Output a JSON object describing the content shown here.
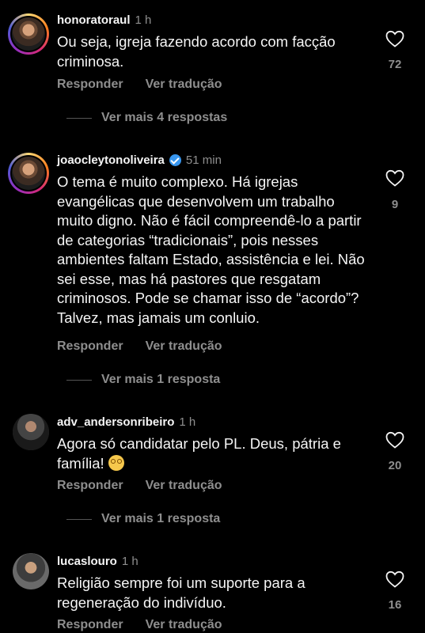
{
  "comments": [
    {
      "username": "honoratoraul",
      "time": "1 h",
      "text": "Ou seja, igreja fazendo acordo com facção criminosa.",
      "likes": "72",
      "verified": false,
      "reply_label": "Responder",
      "translate_label": "Ver tradução",
      "more_replies": "Ver mais 4 respostas"
    },
    {
      "username": "joaocleytonoliveira",
      "time": "51 min",
      "text": "O tema é muito complexo. Há igrejas evangélicas que desenvolvem um trabalho muito digno. Não é fácil compreendê-lo a partir de categorias “tradicionais”, pois nesses ambientes faltam Estado, assistência e lei. Não sei esse, mas há pastores que resgatam criminosos. Pode se chamar isso de “acordo”? Talvez, mas jamais um conluio.",
      "likes": "9",
      "verified": true,
      "reply_label": "Responder",
      "translate_label": "Ver tradução",
      "more_replies": "Ver mais 1 resposta"
    },
    {
      "username": "adv_andersonribeiro",
      "time": "1 h",
      "text": "Agora só candidatar pelo PL. Deus, pátria e família!",
      "emoji": "flushed-face",
      "likes": "20",
      "verified": false,
      "reply_label": "Responder",
      "translate_label": "Ver tradução",
      "more_replies": "Ver mais 1 resposta"
    },
    {
      "username": "lucaslouro",
      "time": "1 h",
      "text": "Religião sempre foi um suporte para a regeneração do indivíduo.",
      "likes": "16",
      "verified": false,
      "reply_label": "Responder",
      "translate_label": "Ver tradução"
    }
  ],
  "icons": {
    "like": "heart-icon",
    "verified": "verified-badge-icon"
  },
  "colors": {
    "background": "#000000",
    "text": "#f5f5f5",
    "muted": "#8e8e8e",
    "verified": "#3897f0"
  }
}
